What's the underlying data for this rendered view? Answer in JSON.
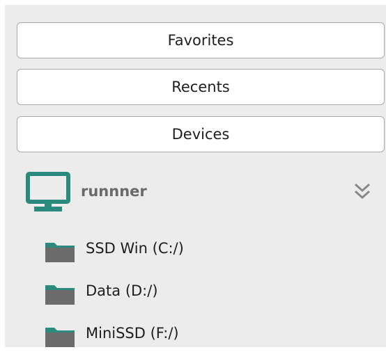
{
  "sections": {
    "favorites_label": "Favorites",
    "recents_label": "Recents",
    "devices_label": "Devices"
  },
  "device": {
    "name": "runnner",
    "icon": "computer-icon",
    "expand_icon": "chevron-double-down-icon"
  },
  "drives": [
    {
      "label": "SSD Win (C:/)",
      "icon": "folder-icon"
    },
    {
      "label": "Data (D:/)",
      "icon": "folder-icon"
    },
    {
      "label": "MiniSSD (F:/)",
      "icon": "folder-icon"
    }
  ],
  "colors": {
    "panel_background": "#ececec",
    "button_background": "#ffffff",
    "button_border": "#a8a8a8",
    "computer_icon": "#2b8a7e",
    "folder_body": "#6b6b6b",
    "folder_tab": "#2b8a7e",
    "device_name": "#6a6a6a"
  }
}
